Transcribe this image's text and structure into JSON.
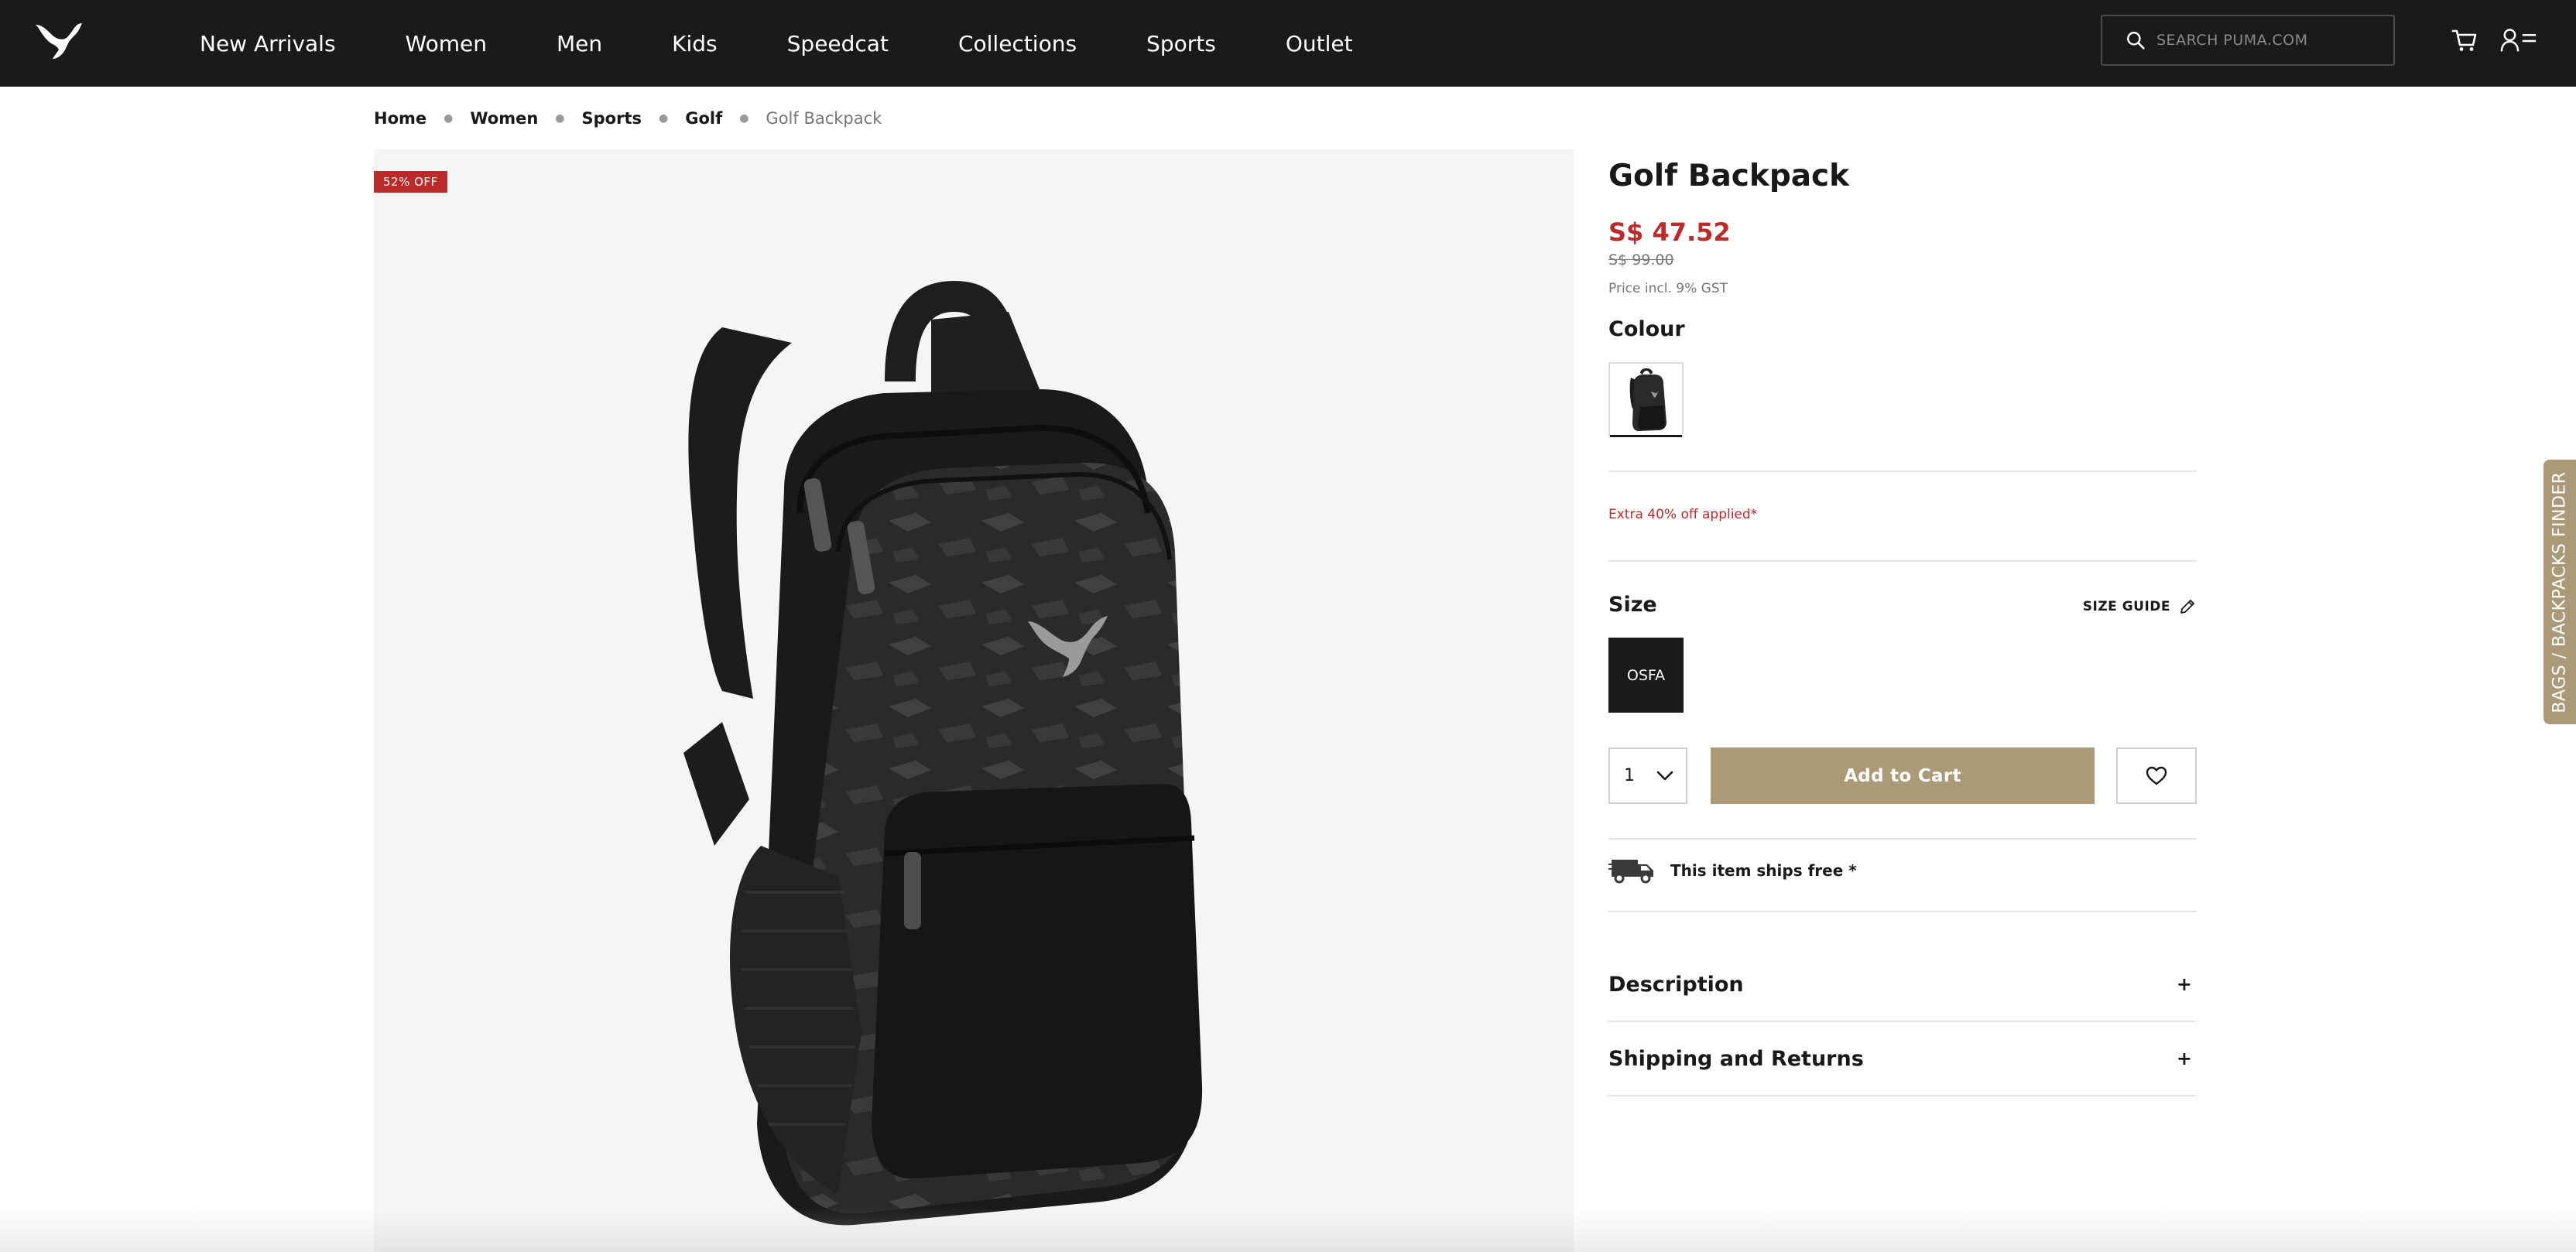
{
  "header": {
    "nav": [
      "New Arrivals",
      "Women",
      "Men",
      "Kids",
      "Speedcat",
      "Collections",
      "Sports",
      "Outlet"
    ],
    "search_placeholder": "SEARCH PUMA.COM"
  },
  "breadcrumb": {
    "links": [
      "Home",
      "Women",
      "Sports",
      "Golf"
    ],
    "current": "Golf Backpack"
  },
  "gallery": {
    "badge": "52% OFF"
  },
  "product": {
    "title": "Golf Backpack",
    "sale_price": "S$ 47.52",
    "original_price": "S$ 99.00",
    "tax_note": "Price incl. 9% GST",
    "colour_label": "Colour",
    "promo": "Extra 40% off applied*",
    "size_label": "Size",
    "size_guide": "SIZE GUIDE",
    "size_option": "OSFA",
    "quantity": "1",
    "add_to_cart": "Add to Cart",
    "shipping": "This item ships free *",
    "accordion": [
      "Description",
      "Shipping and Returns"
    ]
  },
  "side_tab": "BAGS / BACKPACKS FINDER",
  "colors": {
    "header_bg": "#1a1a1a",
    "sale_red": "#ba2b2b",
    "accent_gold": "#ab9a78"
  }
}
